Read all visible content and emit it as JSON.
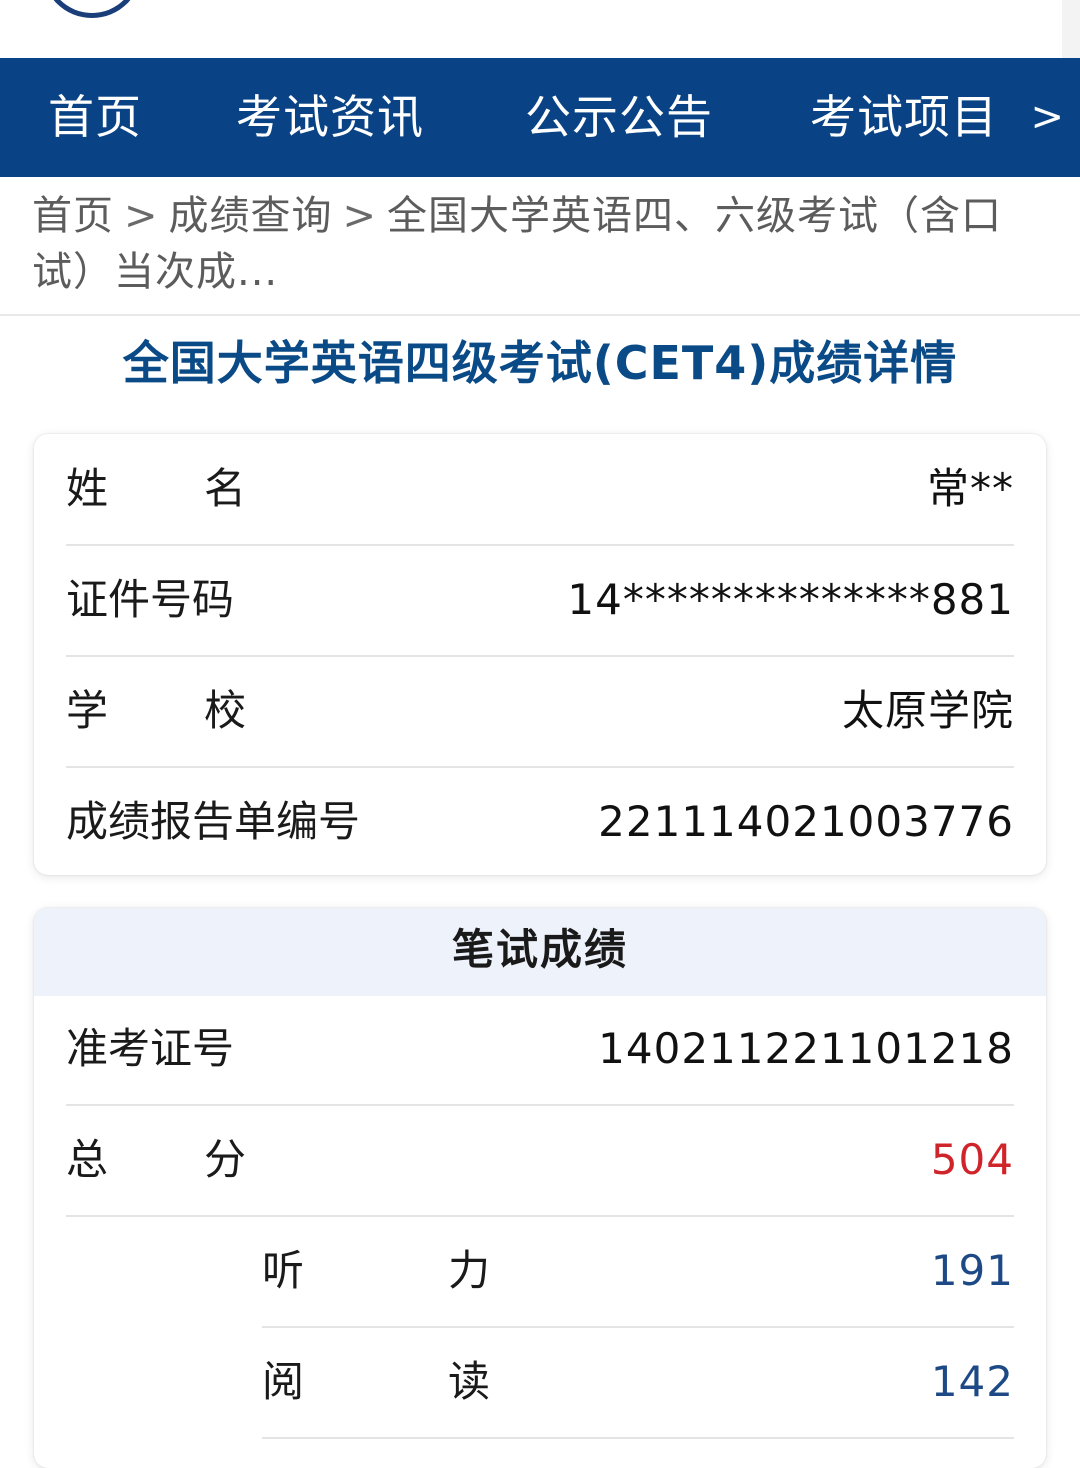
{
  "header": {
    "logo": "exam-center-emblem"
  },
  "nav": {
    "items": [
      {
        "label": "首页"
      },
      {
        "label": "考试资讯"
      },
      {
        "label": "公示公告"
      },
      {
        "label": "考试项目"
      }
    ],
    "more": ">"
  },
  "breadcrumb": {
    "home": "首页",
    "sep": ">",
    "level2": "成绩查询",
    "current": "全国大学英语四、六级考试（含口试）当次成..."
  },
  "page": {
    "title": "全国大学英语四级考试(CET4)成绩详情"
  },
  "info": {
    "name_label_1": "姓",
    "name_label_2": "名",
    "name_value": "常**",
    "id_label": "证件号码",
    "id_value": "14**************881",
    "school_label_1": "学",
    "school_label_2": "校",
    "school_value": "太原学院",
    "report_label": "成绩报告单编号",
    "report_value": "221114021003776"
  },
  "written": {
    "header": "笔试成绩",
    "ticket_label": "准考证号",
    "ticket_value": "140211221101218",
    "total_label_1": "总",
    "total_label_2": "分",
    "total_value": "504",
    "listening_label_1": "听",
    "listening_label_2": "力",
    "listening_value": "191",
    "reading_label_1": "阅",
    "reading_label_2": "读",
    "reading_value": "142"
  },
  "colors": {
    "nav_bg": "#0a4385",
    "title": "#0a4a86",
    "total_score": "#d0242b",
    "sub_score": "#1d4a86",
    "card_header_bg": "#eef2fa"
  }
}
